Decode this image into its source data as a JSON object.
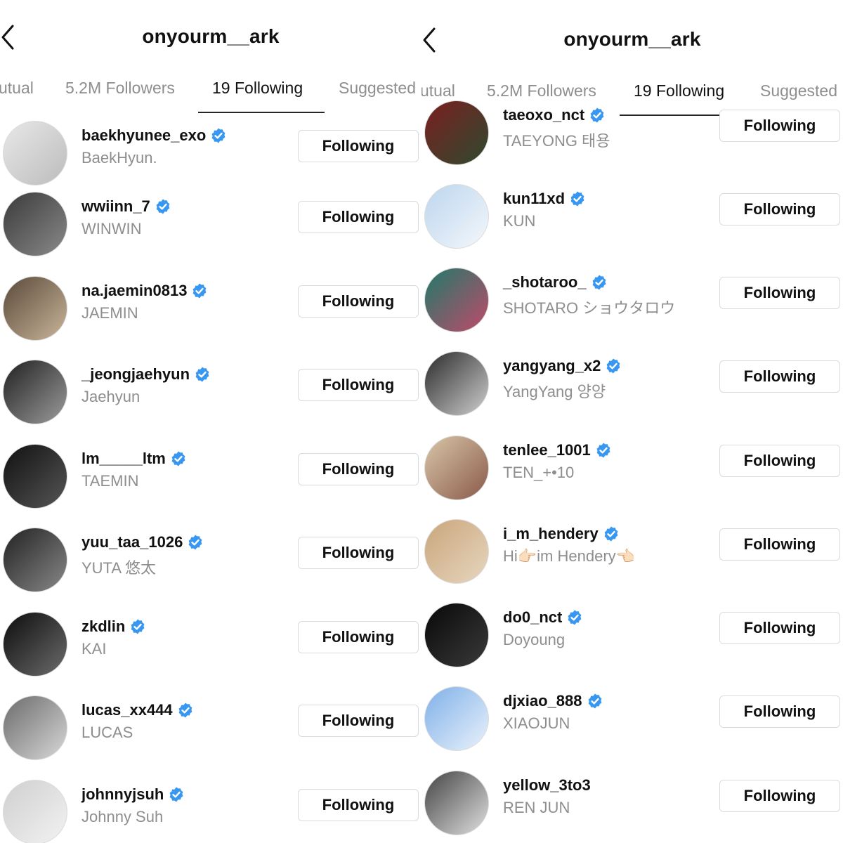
{
  "panels": [
    {
      "title": "onyourm__ark",
      "tabs": [
        {
          "label": "utual"
        },
        {
          "label": "5.2M Followers"
        },
        {
          "label": "19 Following",
          "active": true
        },
        {
          "label": "Suggested"
        }
      ],
      "button_label": "Following",
      "users": [
        {
          "username": "baekhyunee_exo",
          "fullname": "BaekHyun."
        },
        {
          "username": "wwiinn_7",
          "fullname": "WINWIN"
        },
        {
          "username": "na.jaemin0813",
          "fullname": "JAEMIN"
        },
        {
          "username": "_jeongjaehyun",
          "fullname": "Jaehyun"
        },
        {
          "username": "lm_____ltm",
          "fullname": "TAEMIN"
        },
        {
          "username": "yuu_taa_1026",
          "fullname": "YUTA 悠太"
        },
        {
          "username": "zkdlin",
          "fullname": "KAI"
        },
        {
          "username": "lucas_xx444",
          "fullname": "LUCAS"
        },
        {
          "username": "johnnyjsuh",
          "fullname": "Johnny Suh"
        }
      ]
    },
    {
      "title": "onyourm__ark",
      "tabs": [
        {
          "label": "utual"
        },
        {
          "label": "5.2M Followers"
        },
        {
          "label": "19 Following",
          "active": true
        },
        {
          "label": "Suggested"
        }
      ],
      "button_label": "Following",
      "users": [
        {
          "username": "taeoxo_nct",
          "fullname": "TAEYONG 태용"
        },
        {
          "username": "kun11xd",
          "fullname": "KUN"
        },
        {
          "username": "_shotaroo_",
          "fullname": "SHOTARO ショウタロウ"
        },
        {
          "username": "yangyang_x2",
          "fullname": "YangYang 양양"
        },
        {
          "username": "tenlee_1001",
          "fullname": "TEN_+•10"
        },
        {
          "username": "i_m_hendery",
          "fullname": "Hi👉🏻im Hendery👈🏻"
        },
        {
          "username": "do0_nct",
          "fullname": "Doyoung"
        },
        {
          "username": "djxiao_888",
          "fullname": "XIAOJUN"
        },
        {
          "username": "yellow_3to3",
          "fullname": "REN JUN"
        }
      ]
    }
  ],
  "colors": {
    "verified": "#3897f0",
    "secondary_text": "#8e8e8e",
    "button_border": "#dbdbdb"
  }
}
